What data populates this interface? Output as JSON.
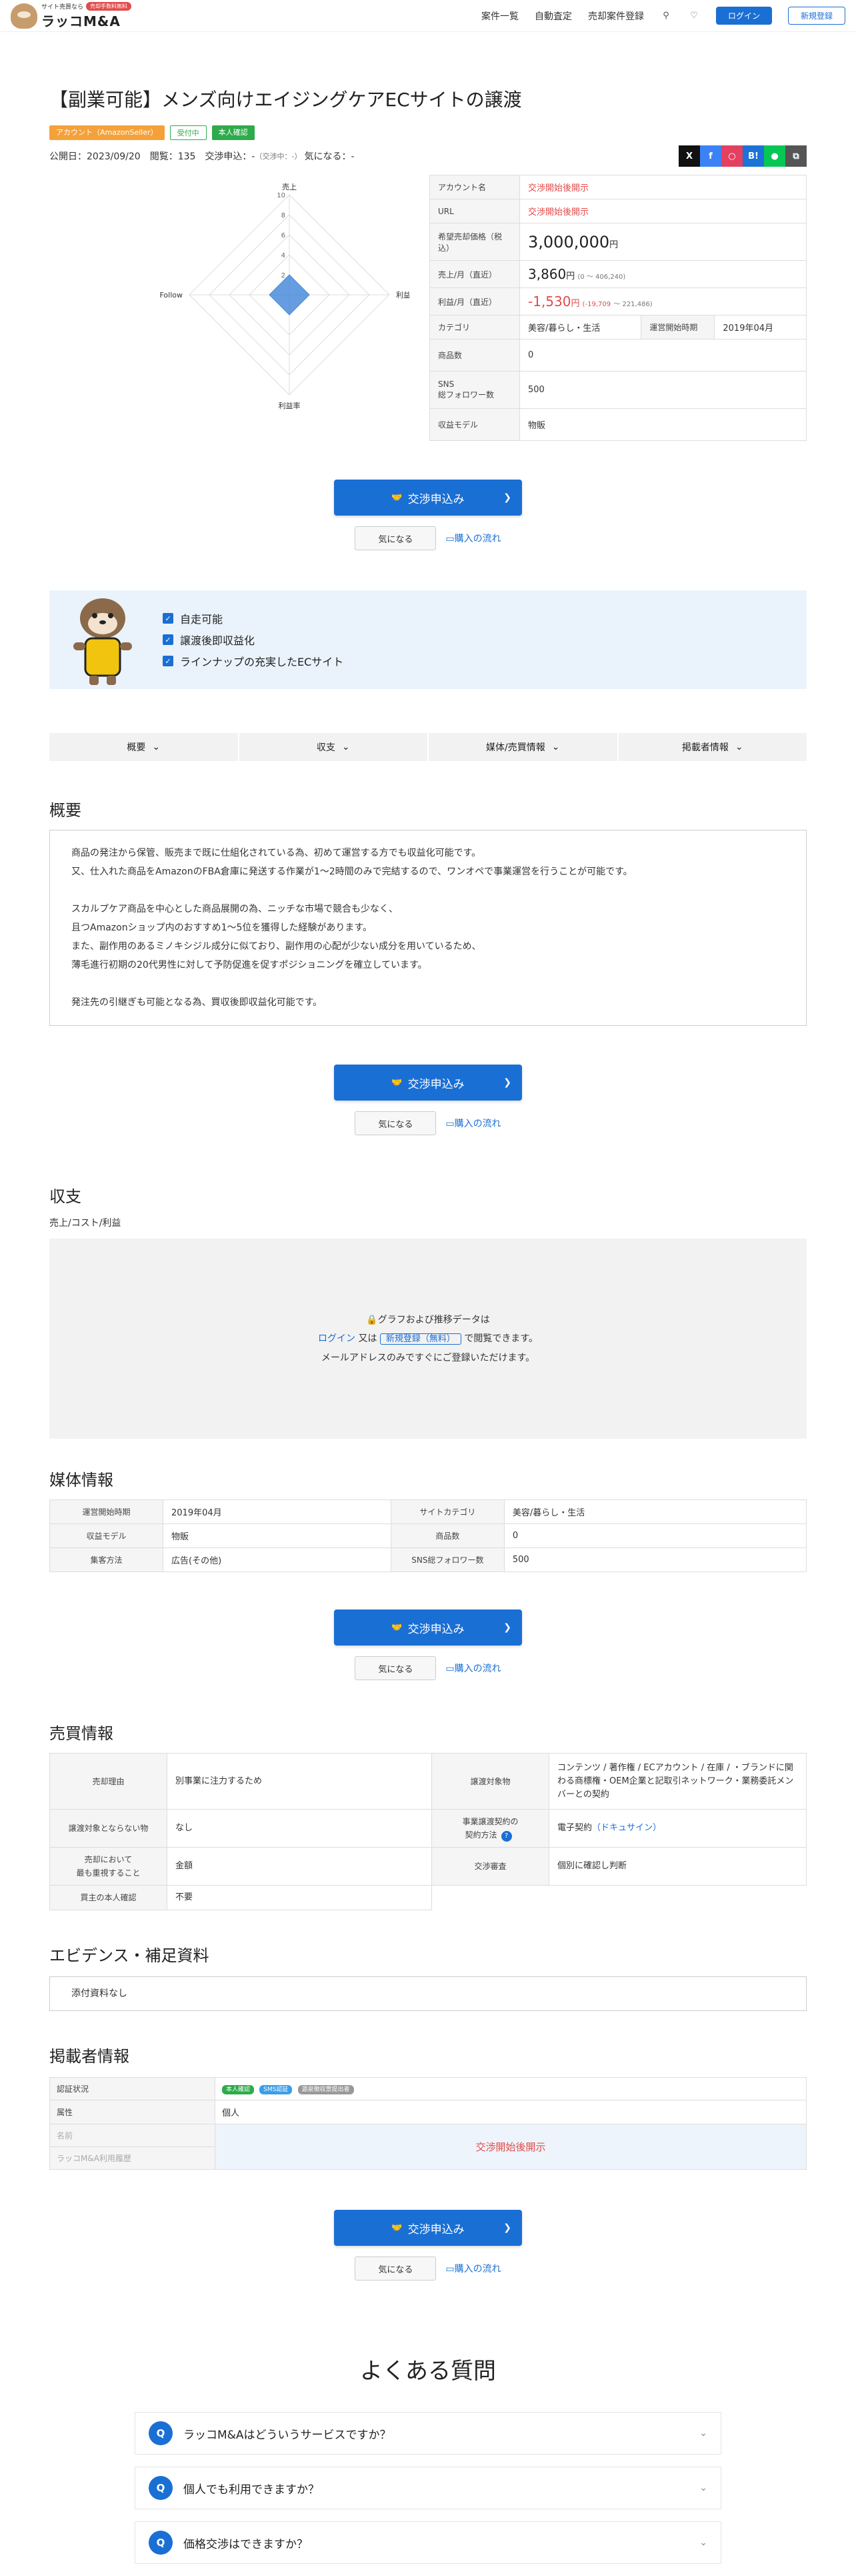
{
  "header": {
    "logo_tagline": "サイト売買なら",
    "logo_badge": "売却手数料無料",
    "logo_name": "ラッコM&A",
    "nav": [
      "案件一覧",
      "自動査定",
      "売却案件登録"
    ],
    "login": "ログイン",
    "register": "新規登録"
  },
  "listing": {
    "title": "【副業可能】メンズ向けエイジングケアECサイトの譲渡",
    "tags": [
      "アカウント（AmazonSeller）",
      "受付中",
      "本人確認"
    ],
    "meta_main": "公開日：2023/09/20　閲覧：135　交渉申込：-",
    "meta_small": "（交渉中：-）",
    "meta_fav": "気になる：-"
  },
  "radar": {
    "axes": [
      "売上",
      "利益",
      "利益率",
      "Follow"
    ],
    "scale": [
      2,
      4,
      6,
      8,
      10
    ],
    "values": [
      2,
      2,
      2,
      2
    ],
    "color": "#4a8cdb"
  },
  "spec": {
    "account_label": "アカウント名",
    "account_value": "交渉開始後開示",
    "url_label": "URL",
    "url_value": "交渉開始後開示",
    "price_label": "希望売却価格（税込）",
    "price_value": "3,000,000",
    "yen": "円",
    "sales_label": "売上/月（直近）",
    "sales_value": "3,860",
    "sales_note": "(0 〜 406,240)",
    "profit_label": "利益/月（直近）",
    "profit_value": "-1,530",
    "profit_note_neg": "(-19,709",
    "profit_note_pos": "〜 221,486)",
    "category_label": "カテゴリ",
    "category_value": "美容/暮らし・生活",
    "start_label": "運営開始時期",
    "start_value": "2019年04月",
    "products_label": "商品数",
    "products_value": "0",
    "sns_label": "SNS\n総フォロワー数",
    "sns_value": "500",
    "model_label": "収益モデル",
    "model_value": "物販"
  },
  "cta": {
    "apply": "交渉申込み",
    "fav": "気になる",
    "flow": "購入の流れ"
  },
  "highlights": [
    "自走可能",
    "譲渡後即収益化",
    "ラインナップの充実したECサイト"
  ],
  "tabs": [
    "概要",
    "収支",
    "媒体/売買情報",
    "掲載者情報"
  ],
  "overview": {
    "heading": "概要",
    "lines": [
      "商品の発注から保管、販売まで既に仕組化されている為、初めて運営する方でも収益化可能です。",
      "又、仕入れた商品をAmazonのFBA倉庫に発送する作業が1〜2時間のみで完結するので、ワンオペで事業運営を行うことが可能です。",
      "",
      "スカルプケア商品を中心とした商品展開の為、ニッチな市場で競合も少なく、",
      "且つAmazonショップ内のおすすめ1〜5位を獲得した経験があります。",
      "また、副作用のあるミノキシジル成分に似ており、副作用の心配が少ない成分を用いているため、",
      "薄毛進行初期の20代男性に対して予防促進を促すポジショニングを確立しています。",
      "",
      "発注先の引継ぎも可能となる為、買収後即収益化可能です。"
    ]
  },
  "income": {
    "heading": "収支",
    "sub": "売上/コスト/利益",
    "locked": "グラフおよび推移データは",
    "login": "ログイン",
    "or": "又は",
    "register": "新規登録（無料）",
    "after": "で閲覧できます。",
    "email_note": "メールアドレスのみですぐにご登録いただけます。"
  },
  "media": {
    "heading": "媒体情報",
    "rows": [
      [
        "運営開始時期",
        "2019年04月",
        "サイトカテゴリ",
        "美容/暮らし・生活"
      ],
      [
        "収益モデル",
        "物販",
        "商品数",
        "0"
      ],
      [
        "集客方法",
        "広告(その他)",
        "SNS総フォロワー数",
        "500"
      ]
    ]
  },
  "sale": {
    "heading": "売買情報",
    "reason_label": "売却理由",
    "reason_value": "別事業に注力するため",
    "assets_label": "譲渡対象物",
    "assets_value": "コンテンツ / 著作権 / ECアカウント / 在庫 / ・ブランドに関わる商標権・OEM企業と記取引ネットワーク・業務委託メンバーとの契約",
    "excluded_label": "譲渡対象とならない物",
    "excluded_value": "なし",
    "contract_label": "事業譲渡契約の\n契約方法",
    "contract_value": "電子契約",
    "contract_link": "（ドキュサイン）",
    "priority_label": "売却において\n最も重視すること",
    "priority_value": "金額",
    "review_label": "交渉審査",
    "review_value": "個別に確認し判断",
    "kyc_label": "買主の本人確認",
    "kyc_value": "不要"
  },
  "evidence": {
    "heading": "エビデンス・補足資料",
    "value": "添付資料なし"
  },
  "poster": {
    "heading": "掲載者情報",
    "auth_label": "認証状況",
    "badges": [
      "本人確認",
      "SMS認証",
      "源泉徴収票提出者"
    ],
    "attr_label": "属性",
    "attr_value": "個人",
    "name_label": "名前",
    "usage_label": "ラッコM&A利用履歴",
    "hidden": "交渉開始後開示"
  },
  "faq": {
    "heading": "よくある質問",
    "items": [
      "ラッコM&Aはどういうサービスですか？",
      "個人でも利用できますか？",
      "価格交渉はできますか？"
    ]
  },
  "colors": {
    "primary": "#1a6fd4",
    "danger": "#e24b4b",
    "success": "#2eab4b",
    "warning": "#f5a13a"
  }
}
